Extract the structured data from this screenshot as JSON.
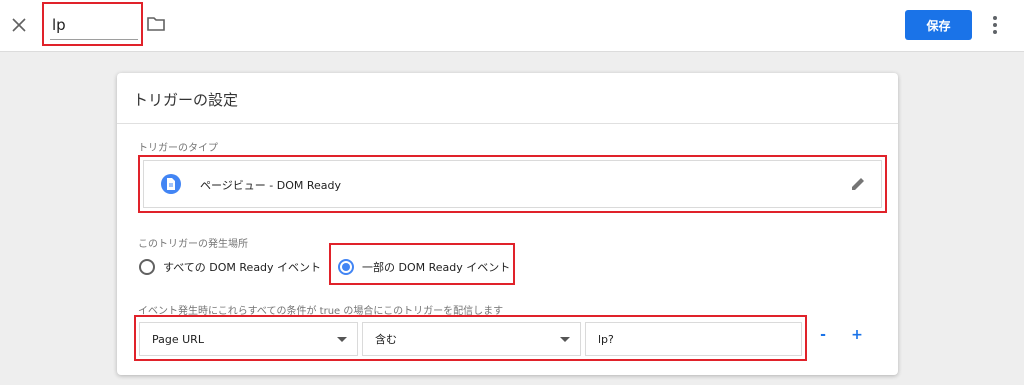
{
  "header": {
    "close_icon": "close-icon",
    "name_value": "lp",
    "folder_icon": "folder-icon",
    "save_label": "保存",
    "more_icon": "more-vert-icon"
  },
  "card": {
    "title": "トリガーの設定",
    "trigger_type": {
      "section_label": "トリガーのタイプ",
      "label": "ページビュー - DOM Ready",
      "icon": "page-icon",
      "edit_icon": "pencil-icon"
    },
    "fires_on": {
      "section_label": "このトリガーの発生場所",
      "options": [
        {
          "label": "すべての DOM Ready イベント",
          "selected": false
        },
        {
          "label": "一部の DOM Ready イベント",
          "selected": true
        }
      ]
    },
    "conditions": {
      "section_label": "イベント発生時にこれらすべての条件が true の場合にこのトリガーを配信します",
      "variable": "Page URL",
      "operator": "含む",
      "value": "lp?",
      "remove_label": "-",
      "add_label": "+"
    }
  },
  "colors": {
    "accent": "#1a73e8",
    "highlight": "#e0222a",
    "radio_selected": "#4285f4"
  }
}
